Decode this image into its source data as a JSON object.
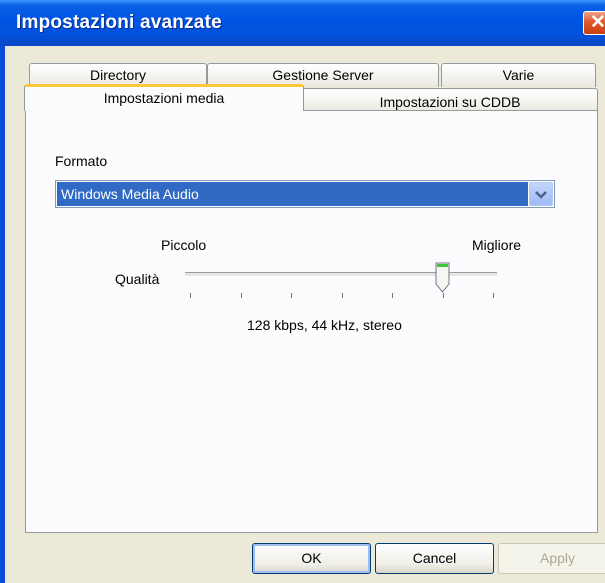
{
  "window": {
    "title": "Impostazioni avanzate",
    "close_glyph": "✕"
  },
  "tabs": {
    "row_back": [
      "Directory",
      "Gestione Server",
      "Varie"
    ],
    "row_front": [
      "Impostazioni media",
      "Impostazioni su CDDB"
    ],
    "active": "Impostazioni media"
  },
  "format": {
    "label": "Formato",
    "selected": "Windows Media Audio",
    "arrow_icon": "chevron-down-icon"
  },
  "quality": {
    "label": "Qualità",
    "min_label": "Piccolo",
    "max_label": "Migliore",
    "ticks": 7,
    "value_position": 6,
    "description": "128 kbps, 44 kHz, stereo"
  },
  "buttons": {
    "ok": "OK",
    "cancel": "Cancel",
    "apply": "Apply"
  },
  "colors": {
    "titlebar": "#0055e5",
    "selection": "#316ac5",
    "tab_highlight": "#ffc83c",
    "close": "#e0582e"
  }
}
